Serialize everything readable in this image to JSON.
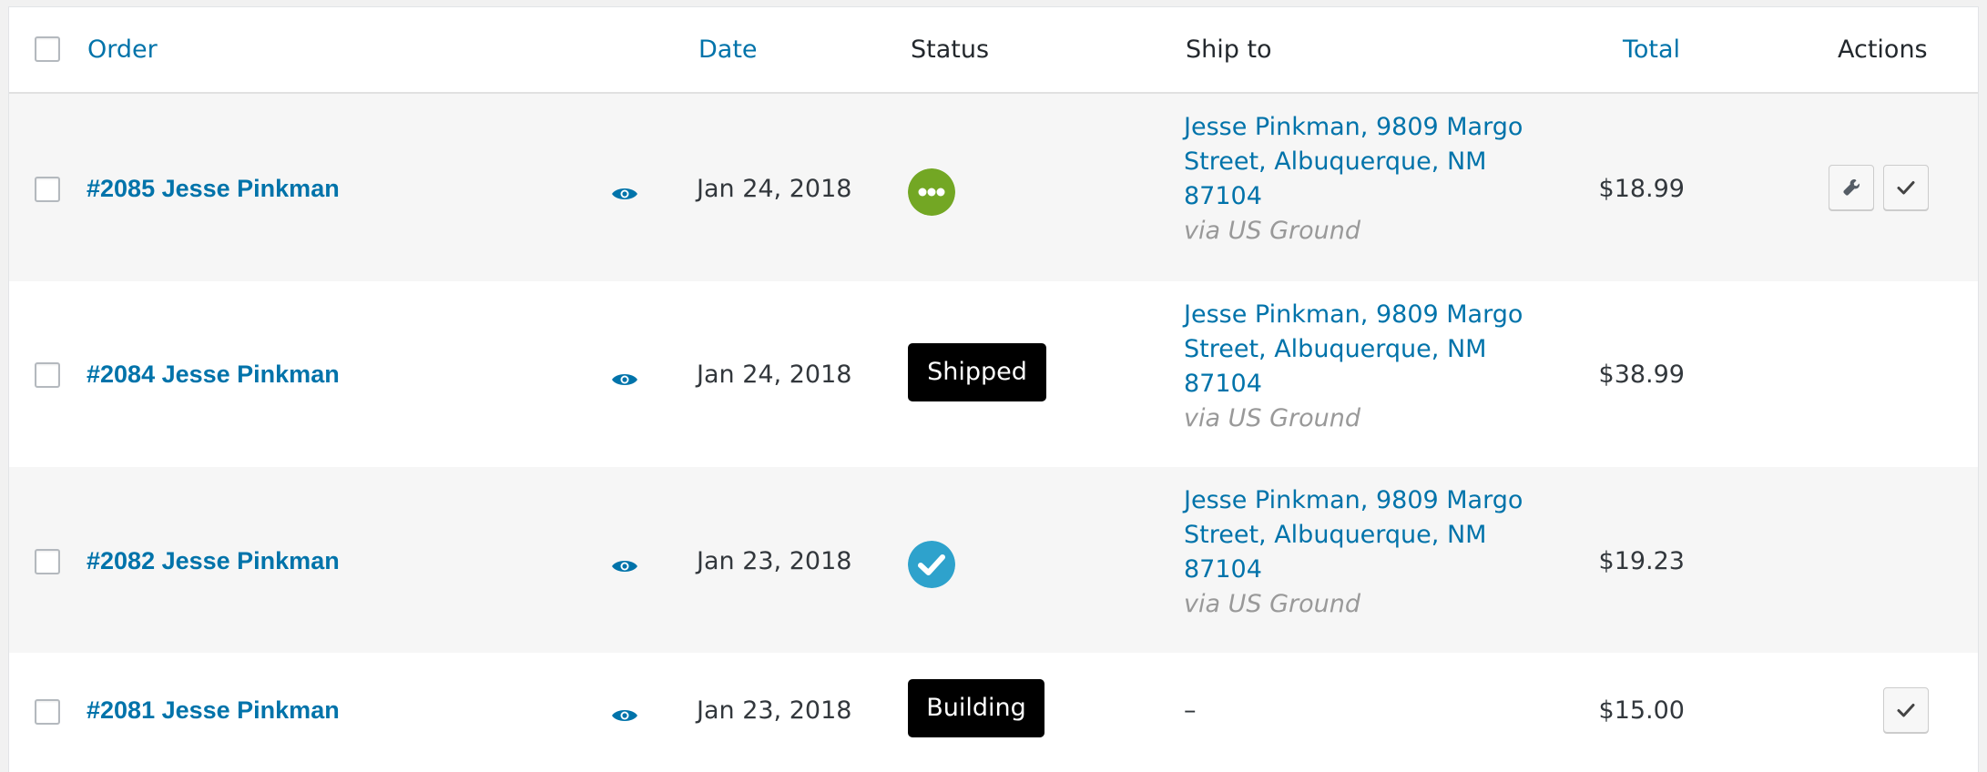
{
  "table": {
    "headers": {
      "order": "Order",
      "date": "Date",
      "status": "Status",
      "ship_to": "Ship to",
      "total": "Total",
      "actions": "Actions"
    }
  },
  "colors": {
    "link": "#0073aa",
    "status_processing": "#73a724",
    "status_completed": "#2ea2cc",
    "pill_bg": "#000000"
  },
  "orders": [
    {
      "label": "#2085 Jesse Pinkman",
      "date": "Jan 24, 2018",
      "status": {
        "type": "icon",
        "name": "processing-dots-icon"
      },
      "ship_address": "Jesse Pinkman, 9809 Margo Street, Albuquerque, NM 87104",
      "ship_via": "via US Ground",
      "total": "$18.99",
      "actions": [
        "wrench-icon",
        "check-icon"
      ]
    },
    {
      "label": "#2084 Jesse Pinkman",
      "date": "Jan 24, 2018",
      "status": {
        "type": "pill",
        "label": "Shipped"
      },
      "ship_address": "Jesse Pinkman, 9809 Margo Street, Albuquerque, NM 87104",
      "ship_via": "via US Ground",
      "total": "$38.99",
      "actions": []
    },
    {
      "label": "#2082 Jesse Pinkman",
      "date": "Jan 23, 2018",
      "status": {
        "type": "icon",
        "name": "completed-check-icon"
      },
      "ship_address": "Jesse Pinkman, 9809 Margo Street, Albuquerque, NM 87104",
      "ship_via": "via US Ground",
      "total": "$19.23",
      "actions": []
    },
    {
      "label": "#2081 Jesse Pinkman",
      "date": "Jan 23, 2018",
      "status": {
        "type": "pill",
        "label": "Building"
      },
      "ship_address": "–",
      "ship_via": "",
      "total": "$15.00",
      "actions": [
        "check-icon"
      ]
    }
  ]
}
